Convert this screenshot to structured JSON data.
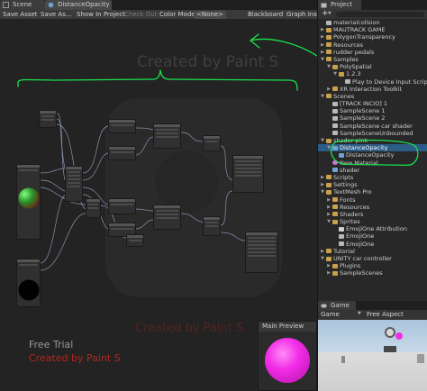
{
  "tabs": {
    "scene": "Scene",
    "graph": "DistanceOpacity",
    "project": "Project",
    "game": "Game"
  },
  "toolbar": {
    "save_asset": "Save Asset",
    "save_as": "Save As...",
    "show_in_project": "Show In Project",
    "check_out": "Check Out",
    "color_mode_label": "Color Mode",
    "color_mode_value": "<None>",
    "blackboard": "Blackboard",
    "graph_inspector": "Graph Inspe"
  },
  "graph": {
    "watermark_top": "Created by Paint S",
    "free_trial": "Free Trial",
    "created_by": "Created by Paint S",
    "main_preview_title": "Main Preview"
  },
  "project_panel": {
    "add_button": "+",
    "items": [
      {
        "label": "materialcolision",
        "depth": 0,
        "icon": "asset"
      },
      {
        "label": "MAUTRACK GAME",
        "depth": 0,
        "icon": "folder"
      },
      {
        "label": "PolygonTransparency",
        "depth": 0,
        "icon": "folder"
      },
      {
        "label": "Resources",
        "depth": 0,
        "icon": "folder"
      },
      {
        "label": "rudder pedals",
        "depth": 0,
        "icon": "folder"
      },
      {
        "label": "Samples",
        "depth": 0,
        "icon": "folder",
        "expanded": true
      },
      {
        "label": "PolySpatial",
        "depth": 1,
        "icon": "folder",
        "expanded": true
      },
      {
        "label": "1.2.3",
        "depth": 2,
        "icon": "folder",
        "expanded": true
      },
      {
        "label": "Play to Device Input Script",
        "depth": 3,
        "icon": "asset"
      },
      {
        "label": "XR Interaction Toolkit",
        "depth": 1,
        "icon": "folder"
      },
      {
        "label": "Scenes",
        "depth": 0,
        "icon": "folder",
        "expanded": true
      },
      {
        "label": "[TRACK INCIO] 1",
        "depth": 1,
        "icon": "asset"
      },
      {
        "label": "SampleScene 1",
        "depth": 1,
        "icon": "asset"
      },
      {
        "label": "SampleScene 2",
        "depth": 1,
        "icon": "asset"
      },
      {
        "label": "SampleScene car shader",
        "depth": 1,
        "icon": "asset"
      },
      {
        "label": "SampleSceneUnbounded",
        "depth": 1,
        "icon": "asset"
      },
      {
        "label": "shader pink",
        "depth": 0,
        "icon": "folder",
        "expanded": true
      },
      {
        "label": "DistanceOpacity",
        "depth": 1,
        "icon": "shader",
        "expanded": true,
        "selected": true
      },
      {
        "label": "DistanceOpacity",
        "depth": 2,
        "icon": "shader"
      },
      {
        "label": "New Material",
        "depth": 1,
        "icon": "mat"
      },
      {
        "label": "shader",
        "depth": 1,
        "icon": "shader"
      },
      {
        "label": "Scripts",
        "depth": 0,
        "icon": "folder"
      },
      {
        "label": "Settings",
        "depth": 0,
        "icon": "folder"
      },
      {
        "label": "TextMesh Pro",
        "depth": 0,
        "icon": "folder",
        "expanded": true
      },
      {
        "label": "Fonts",
        "depth": 1,
        "icon": "folder"
      },
      {
        "label": "Resources",
        "depth": 1,
        "icon": "folder"
      },
      {
        "label": "Shaders",
        "depth": 1,
        "icon": "folder"
      },
      {
        "label": "Sprites",
        "depth": 1,
        "icon": "folder",
        "expanded": true
      },
      {
        "label": "EmojiOne Attribution",
        "depth": 2,
        "icon": "font"
      },
      {
        "label": "EmojiOne",
        "depth": 2,
        "icon": "asset"
      },
      {
        "label": "EmojiOne",
        "depth": 2,
        "icon": "asset"
      },
      {
        "label": "Tutorial",
        "depth": 0,
        "icon": "folder"
      },
      {
        "label": "UNITY car controller",
        "depth": 0,
        "icon": "folder",
        "expanded": true
      },
      {
        "label": "Plugins",
        "depth": 1,
        "icon": "folder"
      },
      {
        "label": "SampleScenes",
        "depth": 1,
        "icon": "folder"
      }
    ]
  },
  "game_panel": {
    "display_label": "Game",
    "aspect_label": "Free Aspect"
  },
  "colors": {
    "annotation_green": "#19e24d",
    "selection_blue": "#2c5d87",
    "preview_magenta": "#f22de7",
    "watermark_red": "#b2261c"
  }
}
